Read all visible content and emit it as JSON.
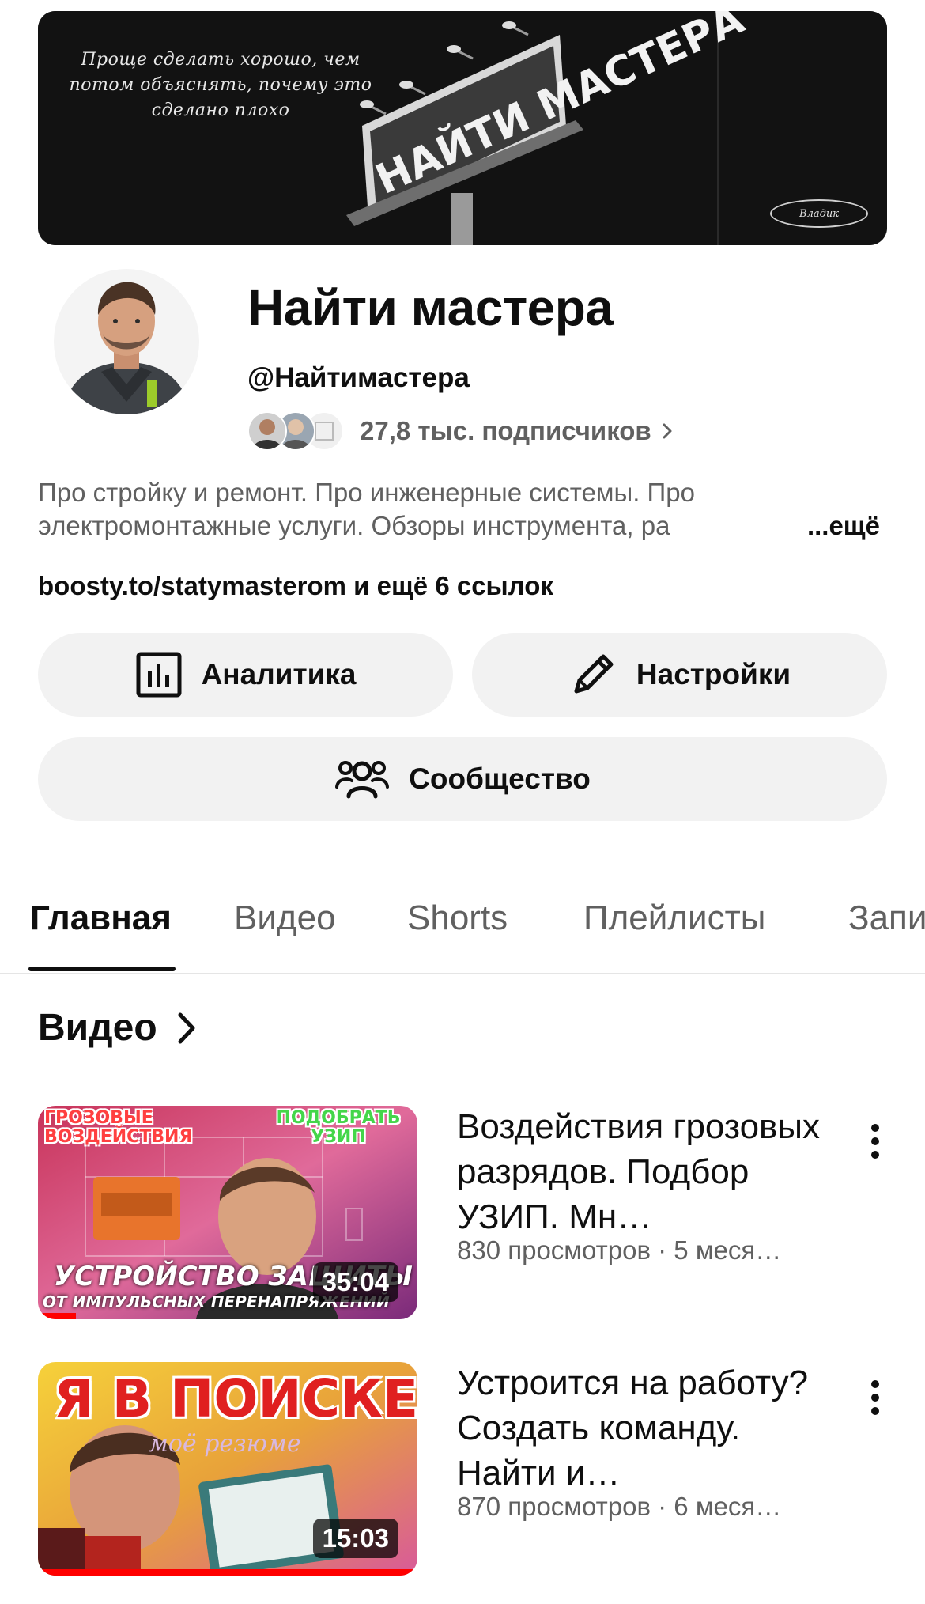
{
  "banner": {
    "quote": "Проще сделать хорошо, чем потом объяснять, почему это сделано плохо",
    "billboard_text": "НАЙТИ МАСТЕРА",
    "signature": "Владик"
  },
  "channel": {
    "name": "Найти мастера",
    "handle": "@Найтимастера",
    "subscribers": "27,8 тыс. подписчиков",
    "description_line1": "Про стройку и ремонт. Про инженерные системы. Про",
    "description_line2": "электромонтажные услуги. Обзоры инструмента, ра",
    "description_more": "...ещё",
    "links": "boosty.to/statymasterom и ещё 6 ссылок"
  },
  "buttons": {
    "analytics": "Аналитика",
    "settings": "Настройки",
    "community": "Сообщество"
  },
  "tabs": [
    {
      "label": "Главная",
      "active": true
    },
    {
      "label": "Видео",
      "active": false
    },
    {
      "label": "Shorts",
      "active": false
    },
    {
      "label": "Плейлисты",
      "active": false
    },
    {
      "label": "Записи",
      "active": false
    }
  ],
  "section": {
    "title": "Видео"
  },
  "videos": [
    {
      "title": "Воздействия грозовых разрядов. Подбор УЗИП. Мн…",
      "meta": "830 просмотров · 5 меся…",
      "duration": "35:04",
      "thumb_text_top_left": "ГРОЗОВЫЕ ВОЗДЕЙСТВИЯ",
      "thumb_text_top_right": "ПОДОБРАТЬ УЗИП",
      "thumb_text_bottom": "УСТРОЙСТВО ЗАЩИТЫ",
      "thumb_text_bottom2": "ОТ ИМПУЛЬСНЫХ ПЕРЕНАПРЯЖЕНИЙ",
      "progress": 0.1
    },
    {
      "title": "Устроится на работу? Создать команду. Найти и…",
      "meta": "870 просмотров · 6 меся…",
      "duration": "15:03",
      "thumb_text_top": "Я В ПОИСКЕ",
      "thumb_text_sub": "моё резюме",
      "progress": 1.0
    }
  ],
  "colors": {
    "text_primary": "#0f0f0f",
    "text_secondary": "#606060",
    "pill_bg": "#f2f2f2",
    "progress": "#ff0000"
  }
}
